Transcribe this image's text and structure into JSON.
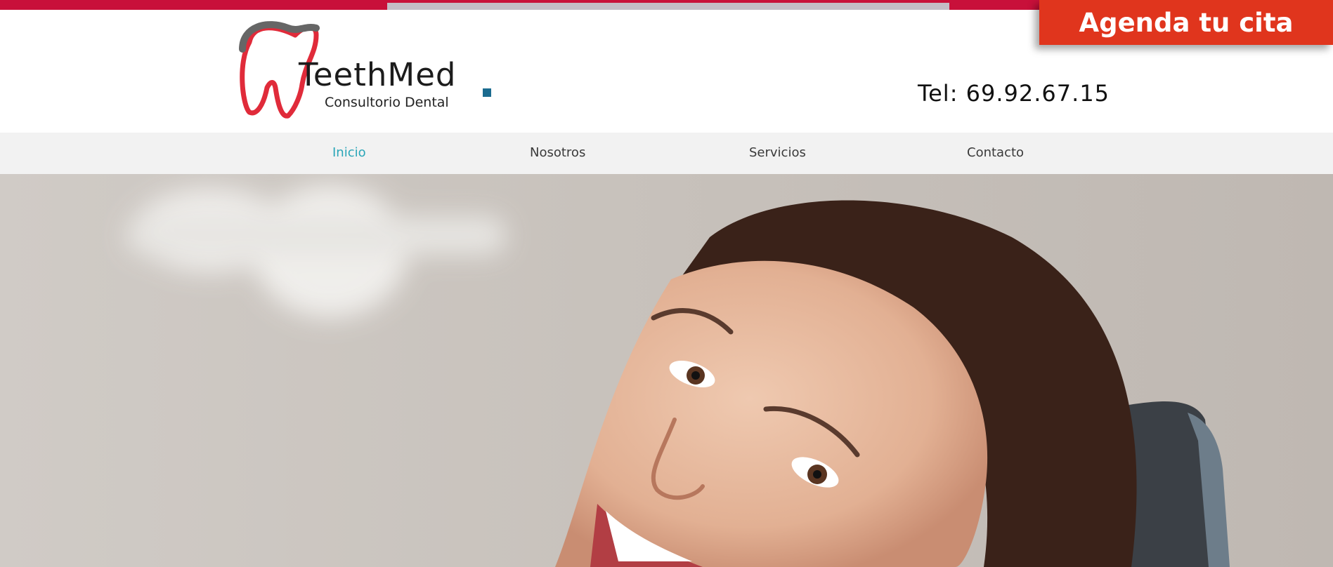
{
  "header": {
    "logo": {
      "name": "TeethMed",
      "subtitle": "Consultorio Dental"
    },
    "phone": "Tel: 69.92.67.15",
    "cta_label": "Agenda tu cita"
  },
  "nav": {
    "items": [
      {
        "label": "Inicio",
        "active": true
      },
      {
        "label": "Nosotros",
        "active": false
      },
      {
        "label": "Servicios",
        "active": false
      },
      {
        "label": "Contacto",
        "active": false
      }
    ]
  },
  "colors": {
    "brand_red": "#c8103a",
    "cta": "#e0351d",
    "nav_active": "#2aa6b8",
    "nav_bg": "#f2f2f2"
  }
}
